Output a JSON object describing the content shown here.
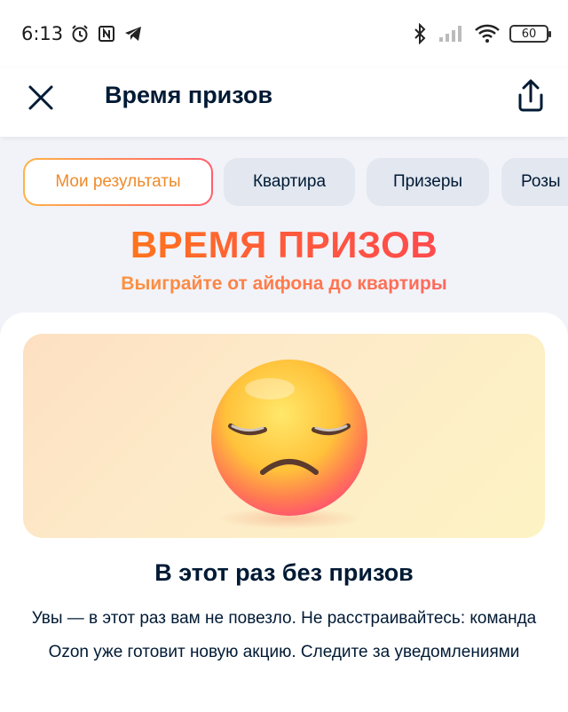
{
  "status_bar": {
    "time": "6:13",
    "icons_left": [
      "alarm-icon",
      "nfc-icon",
      "telegram-icon"
    ],
    "icons_right": [
      "bluetooth-icon",
      "signal-icon",
      "wifi-icon"
    ],
    "battery": "60"
  },
  "header": {
    "title": "Время призов",
    "close_icon": "close-icon",
    "share_icon": "share-icon"
  },
  "tabs": [
    {
      "label": "Мои результаты",
      "active": true
    },
    {
      "label": "Квартира",
      "active": false
    },
    {
      "label": "Призеры",
      "active": false
    },
    {
      "label": "Розы",
      "active": false
    }
  ],
  "promo": {
    "title": "ВРЕМЯ ПРИЗОВ",
    "subtitle": "Выиграйте от айфона до квартиры",
    "accent_colors": [
      "#ff8a00",
      "#ff3d5a"
    ]
  },
  "result": {
    "image_icon": "sad-face-emoji",
    "title": "В этот раз без призов",
    "text": "Увы — в этот раз вам не повезло. Не расстраивайтесь: команда Ozon уже готовит новую акцию. Следите за уведомлениями"
  }
}
